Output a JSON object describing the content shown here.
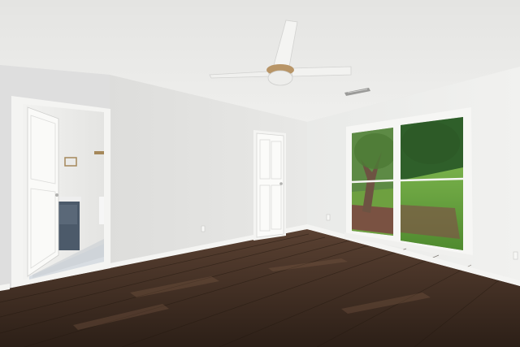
{
  "scene": {
    "subject": "empty bedroom",
    "colors": {
      "ceiling": "#e9e9e7",
      "wall_left": "#e3e3e1",
      "wall_right": "#ecedeb",
      "trim": "#f5f5f3",
      "floor_dark": "#2e2119",
      "floor_mid": "#4a3427",
      "floor_light": "#6b4f3c",
      "vanity": "#4c5a6a",
      "grass": "#5f9a3a",
      "tree": "#2f5f2a",
      "fan_blade": "#f4f4f2"
    },
    "icons": [
      "ceiling-fan-icon",
      "air-vent-icon",
      "window-icon",
      "door-icon"
    ]
  }
}
